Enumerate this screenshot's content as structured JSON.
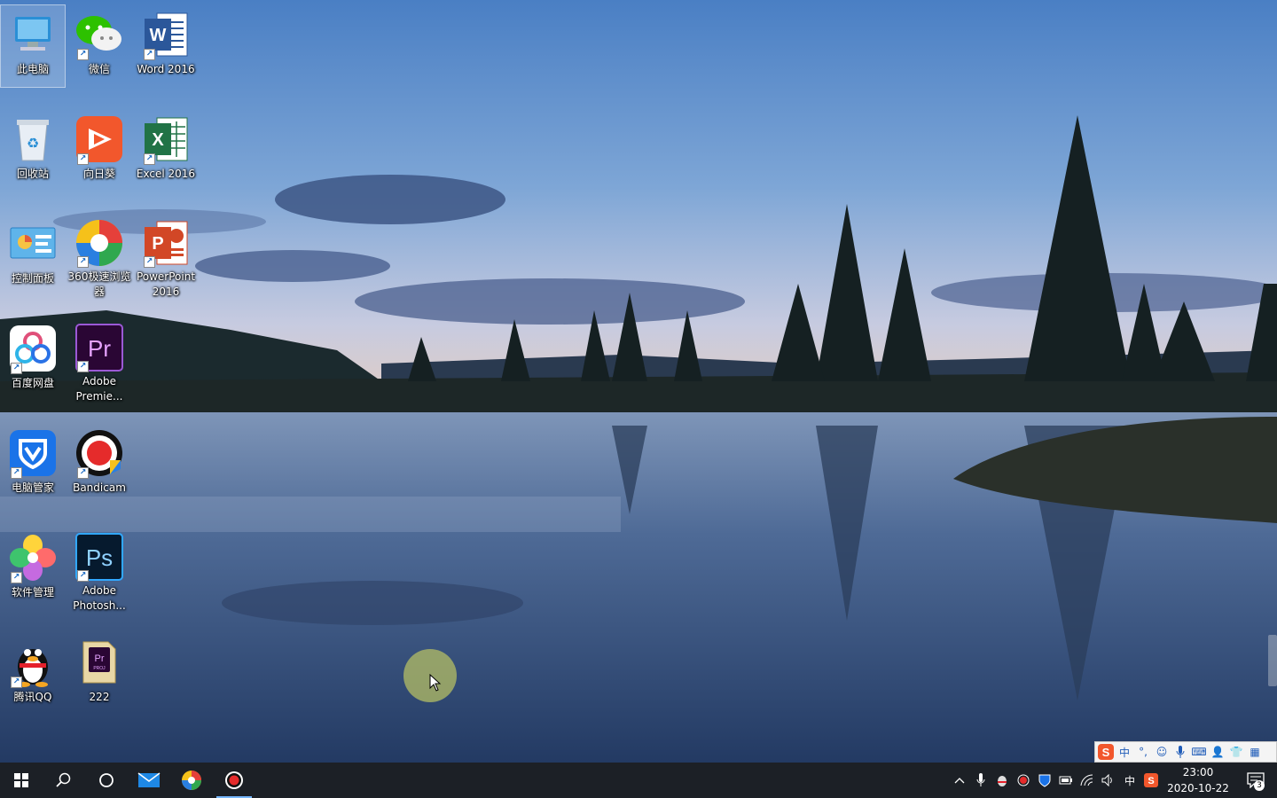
{
  "desktop": {
    "icons": [
      {
        "label": "此电脑",
        "icon": "this-pc-icon"
      },
      {
        "label": "微信",
        "icon": "wechat-icon"
      },
      {
        "label": "Word 2016",
        "icon": "word-icon"
      },
      {
        "label": "回收站",
        "icon": "recycle-bin-icon"
      },
      {
        "label": "向日葵",
        "icon": "sunlogin-icon"
      },
      {
        "label": "Excel 2016",
        "icon": "excel-icon"
      },
      {
        "label": "控制面板",
        "icon": "control-panel-icon"
      },
      {
        "label": "360极速浏览\n器",
        "icon": "360-browser-icon"
      },
      {
        "label": "PowerPoint\n2016",
        "icon": "powerpoint-icon"
      },
      {
        "label": "百度网盘",
        "icon": "baidu-netdisk-icon"
      },
      {
        "label": "Adobe\nPremie...",
        "icon": "premiere-icon"
      },
      {
        "label": "电脑管家",
        "icon": "pc-manager-icon"
      },
      {
        "label": "Bandicam",
        "icon": "bandicam-icon"
      },
      {
        "label": "软件管理",
        "icon": "software-manager-icon"
      },
      {
        "label": "Adobe\nPhotosh...",
        "icon": "photoshop-icon"
      },
      {
        "label": "腾讯QQ",
        "icon": "qq-icon"
      },
      {
        "label": "222",
        "icon": "premiere-project-file-icon"
      }
    ]
  },
  "ime_toolbar": {
    "mode": "中",
    "icons": [
      "sogou-logo-icon",
      "chinese-mode-icon",
      "punctuation-icon",
      "emoji-icon",
      "microphone-icon",
      "keyboard-icon",
      "user-icon",
      "skin-icon",
      "toolbox-icon"
    ]
  },
  "taskbar": {
    "buttons": [
      "start-icon",
      "search-icon",
      "cortana-icon",
      "mail-icon",
      "360-browser-icon",
      "bandicam-icon"
    ],
    "tray": {
      "icons": [
        "show-hidden-icons",
        "microphone-icon",
        "qq-tray-icon",
        "bandicam-tray-icon",
        "security-icon",
        "battery-icon",
        "network-icon",
        "volume-icon",
        "ime-icon",
        "sogou-tray-icon"
      ],
      "ime_label": "中",
      "time": "23:00",
      "date": "2020-10-22",
      "notification_count": "3"
    }
  },
  "colors": {
    "taskbar_bg": "#1c2026",
    "accent": "#77b7ff",
    "word": "#2b579a",
    "excel": "#217346",
    "powerpoint": "#d24726"
  }
}
